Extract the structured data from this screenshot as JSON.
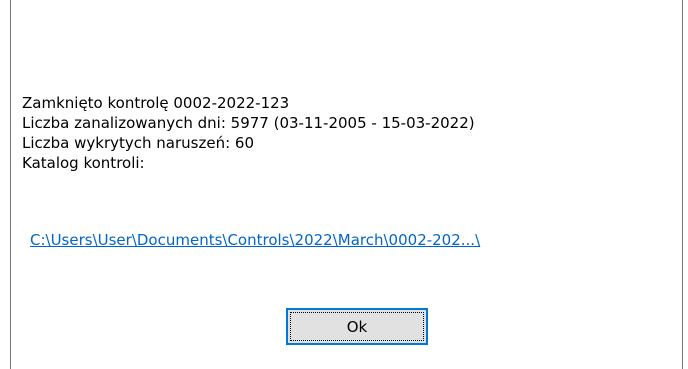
{
  "message": {
    "line1": "Zamknięto kontrolę 0002-2022-123",
    "line2": "Liczba zanalizowanych dni: 5977 (03-11-2005 - 15-03-2022)",
    "line3": "Liczba wykrytych naruszeń: 60",
    "line4": "Katalog kontroli:"
  },
  "link": {
    "text": "C:\\Users\\User\\Documents\\Controls\\2022\\March\\0002-202...\\"
  },
  "buttons": {
    "ok_label": "Ok"
  },
  "colors": {
    "link": "#0066cc",
    "button_border": "#0078d7",
    "button_bg": "#e1e1e1",
    "frame": "#7a7a7a"
  }
}
